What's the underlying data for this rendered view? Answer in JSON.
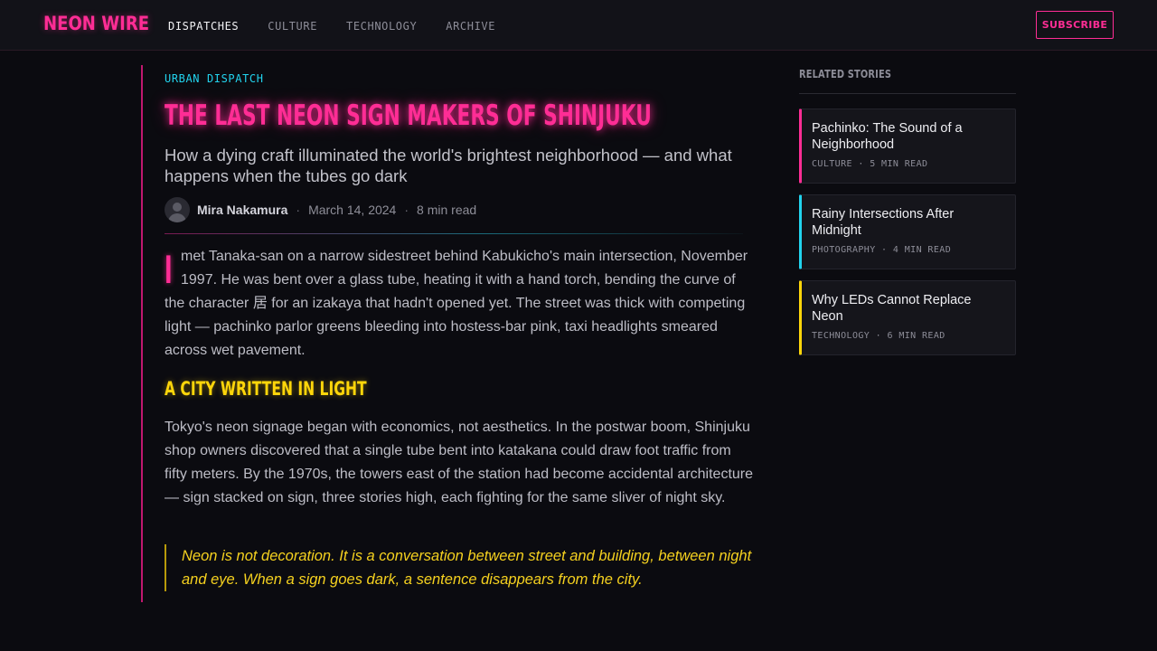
{
  "header": {
    "brand": "NEON WIRE",
    "nav": [
      "DISPATCHES",
      "CULTURE",
      "TECHNOLOGY",
      "ARCHIVE"
    ],
    "active_nav": "DISPATCHES",
    "subscribe_label": "SUBSCRIBE"
  },
  "article": {
    "kicker": "URBAN DISPATCH",
    "headline": "THE LAST NEON SIGN MAKERS OF SHINJUKU",
    "dek": "How a dying craft illuminated the world's brightest neighborhood — and what happens when the tubes go dark",
    "author": "Mira Nakamura",
    "date": "March 14, 2024",
    "read_time": "8 min read",
    "dropcap": "I",
    "paragraph1": "met Tanaka-san on a narrow sidestreet behind Kabukicho's main intersection, November 1997. He was bent over a glass tube, heating it with a hand torch, bending the curve of the character 居 for an izakaya that hadn't opened yet. The street was thick with competing light — pachinko parlor greens bleeding into hostess-bar pink, taxi headlights smeared across wet pavement.",
    "subheading": "A CITY WRITTEN IN LIGHT",
    "paragraph2": "Tokyo's neon signage began with economics, not aesthetics. In the postwar boom, Shinjuku shop owners discovered that a single tube bent into katakana could draw foot traffic from fifty meters. By the 1970s, the towers east of the station had become accidental architecture — sign stacked on sign, three stories high, each fighting for the same sliver of night sky.",
    "pullquote": "Neon is not decoration. It is a conversation between street and building, between night and eye. When a sign goes dark, a sentence disappears from the city."
  },
  "sidebar": {
    "title": "RELATED STORIES",
    "stories": [
      {
        "title": "Pachinko: The Sound of a Neighborhood",
        "category": "CULTURE",
        "read": "5 MIN READ",
        "accent": "#ff2d95"
      },
      {
        "title": "Rainy Intersections After Midnight",
        "category": "PHOTOGRAPHY",
        "read": "4 MIN READ",
        "accent": "#22d3ee"
      },
      {
        "title": "Why LEDs Cannot Replace Neon",
        "category": "TECHNOLOGY",
        "read": "6 MIN READ",
        "accent": "#ffd60a"
      }
    ]
  },
  "colors": {
    "background": "#0b0b10",
    "neon_pink": "#ff2d95",
    "neon_cyan": "#22d3ee",
    "neon_yellow": "#ffd60a"
  },
  "icons": {
    "avatar": "user-avatar-icon"
  }
}
